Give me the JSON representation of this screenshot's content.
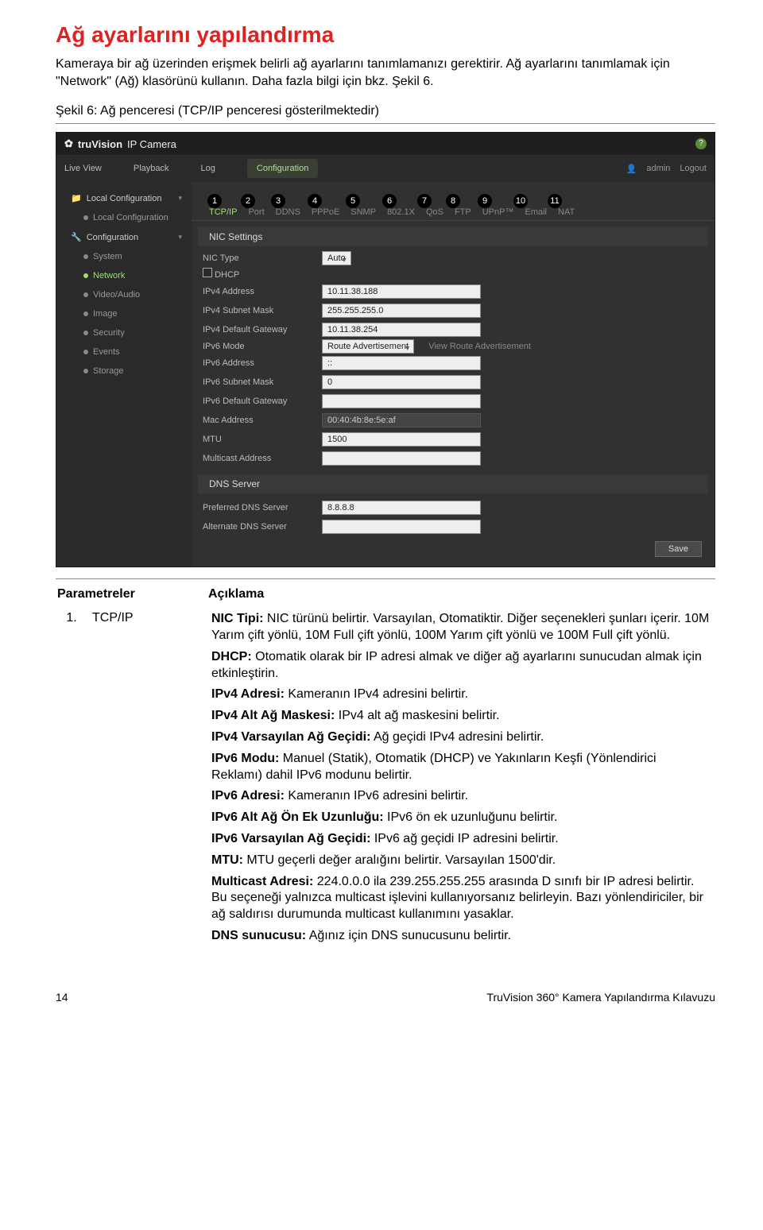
{
  "title": "Ağ ayarlarını yapılandırma",
  "intro": "Kameraya bir ağ üzerinden erişmek belirli ağ ayarlarını tanımlamanızı gerektirir. Ağ ayarlarını tanımlamak için \"Network\" (Ağ) klasörünü kullanın. Daha fazla bilgi için bkz. Şekil 6.",
  "figure_caption": "Şekil 6: Ağ penceresi (TCP/IP penceresi gösterilmektedir)",
  "shot": {
    "brand_tv": "truVision",
    "brand_sub": "IP Camera",
    "help": "?",
    "nav": {
      "live": "Live View",
      "playback": "Playback",
      "log": "Log",
      "config": "Configuration",
      "admin": "admin",
      "logout": "Logout"
    },
    "sidebar": {
      "local_cfg_group": "Local Configuration",
      "local_cfg": "Local Configuration",
      "config_group": "Configuration",
      "system": "System",
      "network": "Network",
      "videoaudio": "Video/Audio",
      "image": "Image",
      "security": "Security",
      "events": "Events",
      "storage": "Storage"
    },
    "subtabs": [
      "TCP/IP",
      "Port",
      "DDNS",
      "PPPoE",
      "SNMP",
      "802.1X",
      "QoS",
      "FTP",
      "UPnP™",
      "Email",
      "NAT"
    ],
    "circles": [
      "1",
      "2",
      "3",
      "4",
      "5",
      "6",
      "7",
      "8",
      "9",
      "10",
      "11"
    ],
    "section_nic": "NIC Settings",
    "rows": {
      "nic_type_lbl": "NIC Type",
      "nic_type_val": "Auto",
      "dhcp_lbl": "DHCP",
      "ipv4_addr_lbl": "IPv4 Address",
      "ipv4_addr_val": "10.11.38.188",
      "ipv4_mask_lbl": "IPv4 Subnet Mask",
      "ipv4_mask_val": "255.255.255.0",
      "ipv4_gw_lbl": "IPv4 Default Gateway",
      "ipv4_gw_val": "10.11.38.254",
      "ipv6_mode_lbl": "IPv6 Mode",
      "ipv6_mode_val": "Route Advertisement",
      "ipv6_hint": "View Route Advertisement",
      "ipv6_addr_lbl": "IPv6 Address",
      "ipv6_addr_val": "::",
      "ipv6_mask_lbl": "IPv6 Subnet Mask",
      "ipv6_mask_val": "0",
      "ipv6_gw_lbl": "IPv6 Default Gateway",
      "ipv6_gw_val": "",
      "mac_lbl": "Mac Address",
      "mac_val": "00:40:4b:8e:5e:af",
      "mtu_lbl": "MTU",
      "mtu_val": "1500",
      "mcast_lbl": "Multicast Address",
      "mcast_val": ""
    },
    "section_dns": "DNS Server",
    "dns": {
      "pref_lbl": "Preferred DNS Server",
      "pref_val": "8.8.8.8",
      "alt_lbl": "Alternate DNS Server",
      "alt_val": ""
    },
    "save": "Save"
  },
  "table": {
    "h1": "Parametreler",
    "h2": "Açıklama",
    "row_num": "1.",
    "row_key": "TCP/IP",
    "desc": {
      "p1a": "NIC Tipi:",
      "p1b": " NIC türünü belirtir. Varsayılan, Otomatiktir. Diğer seçenekleri şunları içerir. 10M Yarım çift yönlü, 10M Full çift yönlü, 100M Yarım çift yönlü ve 100M Full çift yönlü.",
      "p2a": "DHCP:",
      "p2b": " Otomatik olarak bir IP adresi almak ve diğer ağ ayarlarını sunucudan almak için etkinleştirin.",
      "p3a": "IPv4 Adresi:",
      "p3b": " Kameranın IPv4 adresini belirtir.",
      "p4a": "IPv4 Alt Ağ Maskesi:",
      "p4b": " IPv4 alt ağ maskesini belirtir.",
      "p5a": "IPv4 Varsayılan Ağ Geçidi:",
      "p5b": " Ağ geçidi IPv4 adresini belirtir.",
      "p6a": "IPv6 Modu:",
      "p6b": " Manuel (Statik), Otomatik (DHCP) ve Yakınların Keşfi (Yönlendirici Reklamı) dahil IPv6 modunu belirtir.",
      "p7a": "IPv6 Adresi:",
      "p7b": " Kameranın IPv6 adresini belirtir.",
      "p8a": "IPv6 Alt Ağ Ön Ek Uzunluğu:",
      "p8b": " IPv6 ön ek uzunluğunu belirtir.",
      "p9a": "IPv6 Varsayılan Ağ Geçidi:",
      "p9b": " IPv6 ağ geçidi IP adresini belirtir.",
      "p10a": "MTU:",
      "p10b": " MTU geçerli değer aralığını belirtir. Varsayılan 1500'dir.",
      "p11a": "Multicast Adresi:",
      "p11b": " 224.0.0.0 ila 239.255.255.255 arasında D sınıfı bir IP adresi belirtir. Bu seçeneği yalnızca multicast işlevini kullanıyorsanız belirleyin. Bazı yönlendiriciler, bir ağ saldırısı durumunda multicast kullanımını yasaklar.",
      "p12a": "DNS sunucusu:",
      "p12b": " Ağınız için DNS sunucusunu belirtir."
    }
  },
  "footer": {
    "page": "14",
    "doc": "TruVision 360° Kamera Yapılandırma Kılavuzu"
  }
}
